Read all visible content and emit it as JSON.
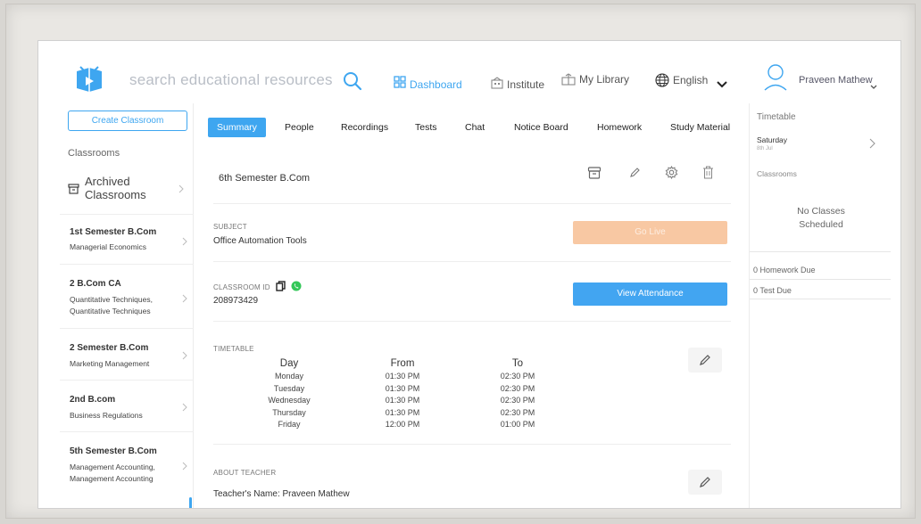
{
  "header": {
    "search_placeholder": "search educational resources",
    "nav": {
      "dashboard": "Dashboard",
      "institute": "Institute",
      "library": "My Library",
      "language": "English"
    },
    "user_name": "Praveen Mathew"
  },
  "sidebar": {
    "create_button": "Create Classroom",
    "heading": "Classrooms",
    "archived_line1": "Archived",
    "archived_line2": "Classrooms",
    "items": [
      {
        "title": "1st Semester B.Com",
        "sub1": "Managerial Economics",
        "sub2": ""
      },
      {
        "title": "2 B.Com CA",
        "sub1": "Quantitative Techniques,",
        "sub2": "Quantitative Techniques"
      },
      {
        "title": "2 Semester B.Com",
        "sub1": "Marketing Management",
        "sub2": ""
      },
      {
        "title": "2nd B.com",
        "sub1": "Business Regulations",
        "sub2": ""
      },
      {
        "title": "5th Semester B.Com",
        "sub1": "Management Accounting,",
        "sub2": "Management Accounting"
      }
    ]
  },
  "main": {
    "tabs": [
      "Summary",
      "People",
      "Recordings",
      "Tests",
      "Chat",
      "Notice Board",
      "Homework",
      "Study Material"
    ],
    "classroom_title": "6th Semester B.Com",
    "subject_label": "SUBJECT",
    "subject_value": "Office Automation Tools",
    "golive_label": "Go Live",
    "classroom_id_label": "CLASSROOM ID",
    "classroom_id_value": "208973429",
    "attendance_label": "View Attendance",
    "timetable_label": "TIMETABLE",
    "timetable": {
      "headers": [
        "Day",
        "From",
        "To"
      ],
      "rows": [
        [
          "Monday",
          "01:30 PM",
          "02:30 PM"
        ],
        [
          "Tuesday",
          "01:30 PM",
          "02:30 PM"
        ],
        [
          "Wednesday",
          "01:30 PM",
          "02:30 PM"
        ],
        [
          "Thursday",
          "01:30 PM",
          "02:30 PM"
        ],
        [
          "Friday",
          "12:00 PM",
          "01:00 PM"
        ]
      ]
    },
    "about_label": "ABOUT TEACHER",
    "teacher_name": "Teacher's Name: Praveen Mathew"
  },
  "right": {
    "timetable_heading": "Timetable",
    "day": "Saturday",
    "date": "8th Jul",
    "classrooms_label": "Classrooms",
    "no_classes_line1": "No Classes",
    "no_classes_line2": "Scheduled",
    "homework_due": "0 Homework Due",
    "test_due": "0 Test Due"
  },
  "colors": {
    "accent": "#3ea6f0",
    "golive": "#f8c8a3",
    "attendance": "#42a5f1"
  }
}
